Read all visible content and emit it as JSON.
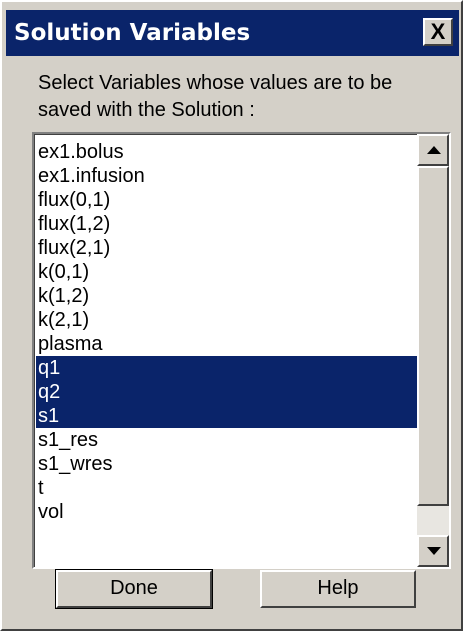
{
  "window": {
    "title": "Solution Variables",
    "close_glyph": "X"
  },
  "prompt": "Select Variables whose values are to be saved with the Solution :",
  "list": {
    "items": [
      {
        "label": "ex1.bolus",
        "selected": false
      },
      {
        "label": "ex1.infusion",
        "selected": false
      },
      {
        "label": "flux(0,1)",
        "selected": false
      },
      {
        "label": "flux(1,2)",
        "selected": false
      },
      {
        "label": "flux(2,1)",
        "selected": false
      },
      {
        "label": "k(0,1)",
        "selected": false
      },
      {
        "label": "k(1,2)",
        "selected": false
      },
      {
        "label": "k(2,1)",
        "selected": false
      },
      {
        "label": "plasma",
        "selected": false
      },
      {
        "label": "q1",
        "selected": true
      },
      {
        "label": "q2",
        "selected": true
      },
      {
        "label": "s1",
        "selected": true
      },
      {
        "label": "s1_res",
        "selected": false
      },
      {
        "label": "s1_wres",
        "selected": false
      },
      {
        "label": "t",
        "selected": false
      },
      {
        "label": "vol",
        "selected": false
      }
    ]
  },
  "buttons": {
    "done": "Done",
    "help": "Help"
  },
  "colors": {
    "selection": "#0a246a",
    "face": "#d4d0c8"
  }
}
